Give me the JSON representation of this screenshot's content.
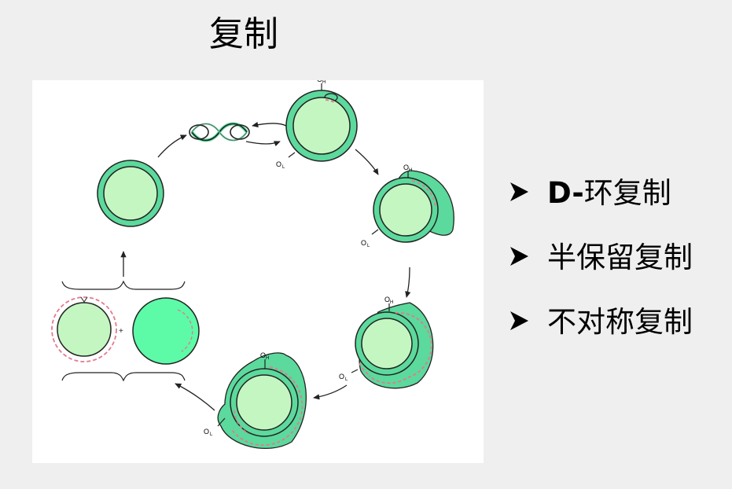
{
  "title": "复制",
  "diagram": {
    "labels": {
      "oh": "O",
      "oh_sub": "H",
      "ol": "O",
      "ol_sub": "L"
    },
    "colors": {
      "outer_strand": "#5cd99c",
      "inner_circle": "#c4f6c1",
      "daughter_full": "#5dfaa8",
      "new_strand_dash": "#e27a8f",
      "line": "#222222"
    }
  },
  "bullets": [
    {
      "bold": "D-",
      "text": "环复制"
    },
    {
      "bold": "",
      "text": "半保留复制"
    },
    {
      "bold": "",
      "text": "不对称复制"
    }
  ]
}
